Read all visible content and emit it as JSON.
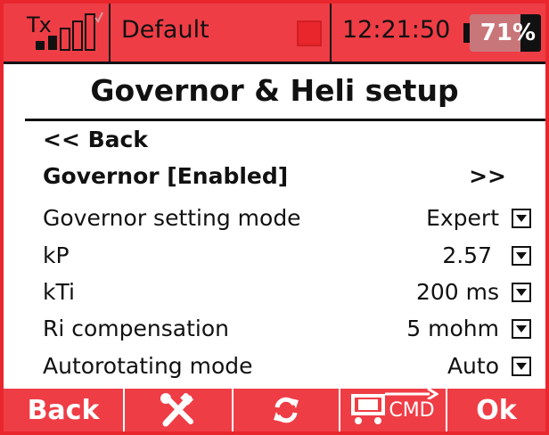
{
  "status_bar": {
    "tx_label": "Tx",
    "model_name": "Default",
    "time": "12:21:50",
    "battery_percent": "71%",
    "battery_level": 0.71
  },
  "title": "Governor & Heli setup",
  "menu": {
    "back": "<< Back",
    "governor": {
      "label": "Governor [Enabled]",
      "nav": ">>"
    },
    "settings": [
      {
        "label": "Governor setting mode",
        "value": "Expert"
      },
      {
        "label": "kP",
        "value": "2.57"
      },
      {
        "label": "kTi",
        "value": "200 ms"
      },
      {
        "label": "Ri compensation",
        "value": "5 mohm"
      },
      {
        "label": "Autorotating mode",
        "value": "Auto"
      }
    ]
  },
  "bottom_bar": {
    "back": "Back",
    "ok": "Ok",
    "cmd": "CMD"
  },
  "colors": {
    "accent": "#ef3d46",
    "frame": "#e8262c",
    "text": "#111111"
  }
}
